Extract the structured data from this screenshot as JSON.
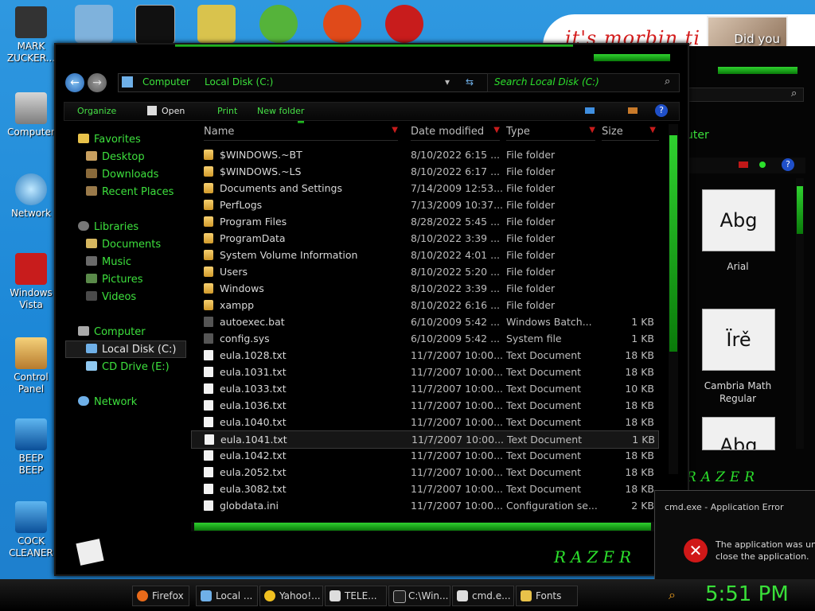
{
  "desktop_icons": [
    {
      "label_1": "MARK",
      "label_2": "ZUCKER...",
      "icon": "zuckerberg-icon"
    },
    {
      "label_1": "Computer",
      "label_2": "",
      "icon": "computer-icon"
    },
    {
      "label_1": "Network",
      "label_2": "",
      "icon": "network-icon"
    },
    {
      "label_1": "Windows",
      "label_2": "Vista",
      "icon": "recycle-bin-icon"
    },
    {
      "label_1": "Control",
      "label_2": "Panel",
      "icon": "control-panel-icon"
    },
    {
      "label_1": "BEEP",
      "label_2": "BEEP",
      "icon": "shortcut-icon"
    },
    {
      "label_1": "COCK",
      "label_2": "CLEANER",
      "icon": "shortcut-icon"
    }
  ],
  "wallpaper_text": "it's morbin ti",
  "wallpaper_photo_caption": "Did you",
  "explorer": {
    "breadcrumb": [
      "Computer",
      "Local Disk (C:)"
    ],
    "search_placeholder": "Search Local Disk (C:)",
    "toolbar": {
      "organize": "Organize",
      "open": "Open",
      "print": "Print",
      "new_folder": "New folder"
    },
    "nav": {
      "favorites": "Favorites",
      "desktop": "Desktop",
      "downloads": "Downloads",
      "recent": "Recent Places",
      "libraries": "Libraries",
      "documents": "Documents",
      "music": "Music",
      "pictures": "Pictures",
      "videos": "Videos",
      "computer": "Computer",
      "local_disk": "Local Disk (C:)",
      "cd_drive": "CD Drive (E:)",
      "network": "Network"
    },
    "columns": {
      "name": "Name",
      "date": "Date modified",
      "type": "Type",
      "size": "Size"
    },
    "rows": [
      {
        "name": "$WINDOWS.~BT",
        "date": "8/10/2022 6:15 ...",
        "type": "File folder",
        "size": "",
        "kind": "folder"
      },
      {
        "name": "$WINDOWS.~LS",
        "date": "8/10/2022 6:17 ...",
        "type": "File folder",
        "size": "",
        "kind": "folder"
      },
      {
        "name": "Documents and Settings",
        "date": "7/14/2009 12:53...",
        "type": "File folder",
        "size": "",
        "kind": "folder"
      },
      {
        "name": "PerfLogs",
        "date": "7/13/2009 10:37...",
        "type": "File folder",
        "size": "",
        "kind": "folder"
      },
      {
        "name": "Program Files",
        "date": "8/28/2022 5:45 ...",
        "type": "File folder",
        "size": "",
        "kind": "folder"
      },
      {
        "name": "ProgramData",
        "date": "8/10/2022 3:39 ...",
        "type": "File folder",
        "size": "",
        "kind": "folder"
      },
      {
        "name": "System Volume Information",
        "date": "8/10/2022 4:01 ...",
        "type": "File folder",
        "size": "",
        "kind": "folder"
      },
      {
        "name": "Users",
        "date": "8/10/2022 5:20 ...",
        "type": "File folder",
        "size": "",
        "kind": "folder"
      },
      {
        "name": "Windows",
        "date": "8/10/2022 3:39 ...",
        "type": "File folder",
        "size": "",
        "kind": "folder"
      },
      {
        "name": "xampp",
        "date": "8/10/2022 6:16 ...",
        "type": "File folder",
        "size": "",
        "kind": "folder"
      },
      {
        "name": "autoexec.bat",
        "date": "6/10/2009 5:42 ...",
        "type": "Windows Batch...",
        "size": "1 KB",
        "kind": "bat"
      },
      {
        "name": "config.sys",
        "date": "6/10/2009 5:42 ...",
        "type": "System file",
        "size": "1 KB",
        "kind": "bat"
      },
      {
        "name": "eula.1028.txt",
        "date": "11/7/2007 10:00...",
        "type": "Text Document",
        "size": "18 KB",
        "kind": "doc"
      },
      {
        "name": "eula.1031.txt",
        "date": "11/7/2007 10:00...",
        "type": "Text Document",
        "size": "18 KB",
        "kind": "doc"
      },
      {
        "name": "eula.1033.txt",
        "date": "11/7/2007 10:00...",
        "type": "Text Document",
        "size": "10 KB",
        "kind": "doc"
      },
      {
        "name": "eula.1036.txt",
        "date": "11/7/2007 10:00...",
        "type": "Text Document",
        "size": "18 KB",
        "kind": "doc"
      },
      {
        "name": "eula.1040.txt",
        "date": "11/7/2007 10:00...",
        "type": "Text Document",
        "size": "18 KB",
        "kind": "doc"
      },
      {
        "name": "eula.1041.txt",
        "date": "11/7/2007 10:00...",
        "type": "Text Document",
        "size": "1 KB",
        "kind": "doc"
      },
      {
        "name": "eula.1042.txt",
        "date": "11/7/2007 10:00...",
        "type": "Text Document",
        "size": "18 KB",
        "kind": "doc"
      },
      {
        "name": "eula.2052.txt",
        "date": "11/7/2007 10:00...",
        "type": "Text Document",
        "size": "18 KB",
        "kind": "doc"
      },
      {
        "name": "eula.3082.txt",
        "date": "11/7/2007 10:00...",
        "type": "Text Document",
        "size": "18 KB",
        "kind": "doc"
      },
      {
        "name": "globdata.ini",
        "date": "11/7/2007 10:00...",
        "type": "Configuration se...",
        "size": "2 KB",
        "kind": "doc"
      }
    ]
  },
  "fonts_window": {
    "title_fragment": "uter",
    "font_1": "Arial",
    "font_1_sample": "Abg",
    "font_2_line1": "Cambria Math",
    "font_2_line2": "Regular",
    "font_2_sample": "Ïrě",
    "font_3_sample": "Abg"
  },
  "razer_logo": "RAZER",
  "error_dialog": {
    "title": "cmd.exe - Application Error",
    "line1": "The application was una",
    "line2": "close the application."
  },
  "taskbar": {
    "buttons": [
      "Firefox",
      "Local ...",
      "Yahoo!...",
      "TELE...",
      "C:\\Win...",
      "cmd.e...",
      "Fonts"
    ],
    "clock": "5:51 PM"
  },
  "colors": {
    "accent": "#39e039",
    "background": "#000000",
    "desktop": "#1b86d6"
  }
}
